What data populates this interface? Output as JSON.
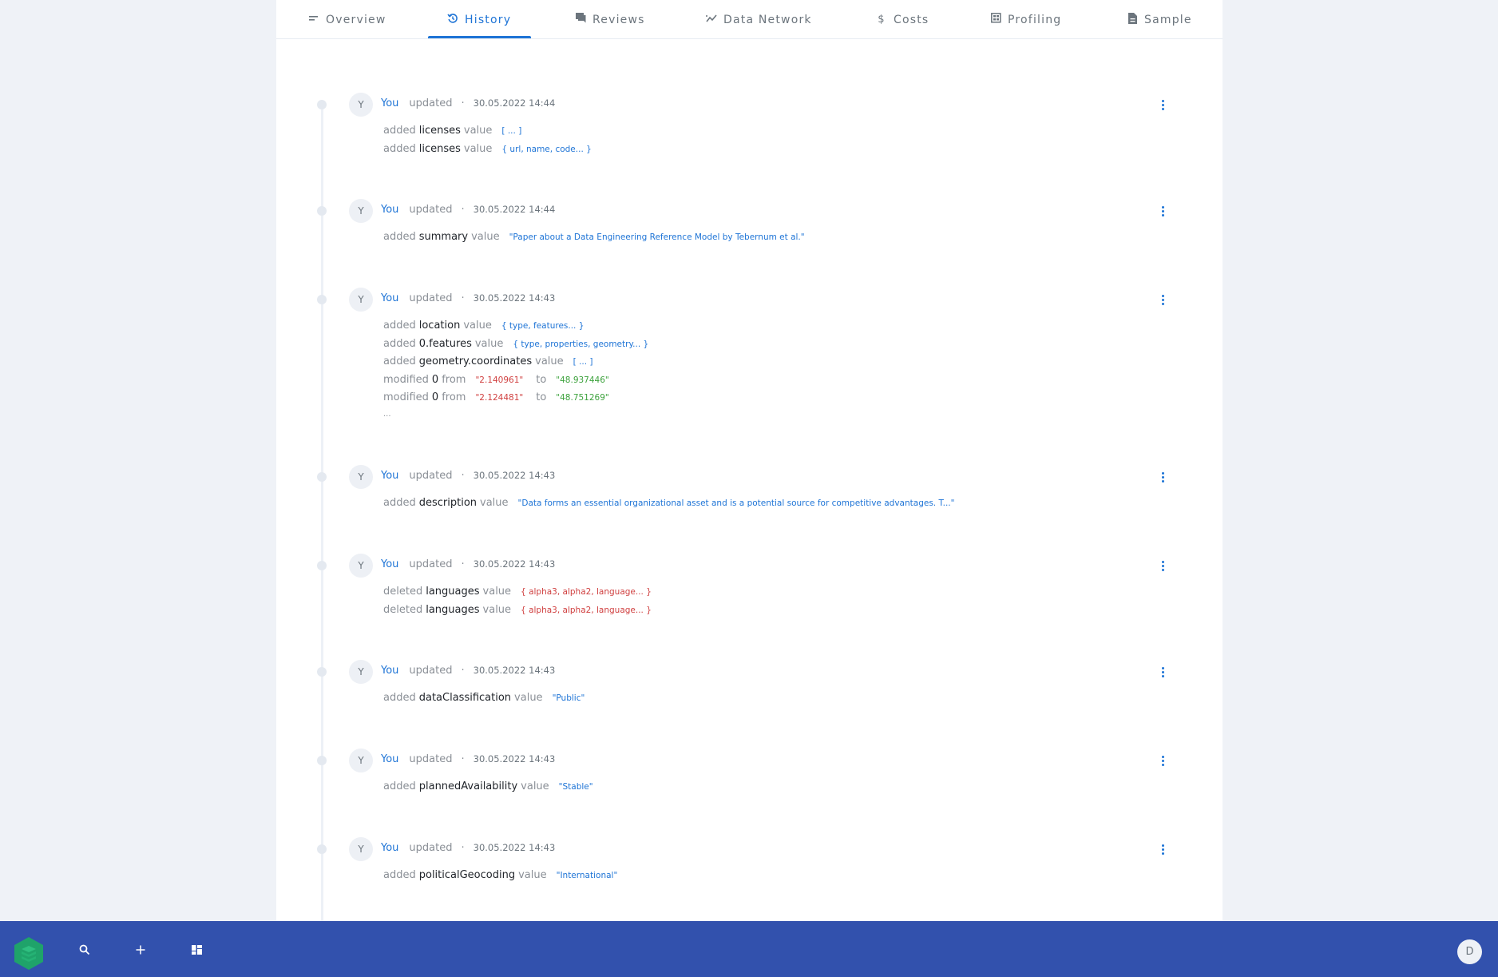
{
  "tabs": [
    {
      "id": "overview",
      "label": "Overview",
      "icon": "short-text-icon",
      "glyph": "≡",
      "active": false
    },
    {
      "id": "history",
      "label": "History",
      "icon": "history-icon",
      "glyph": "⟲",
      "active": true
    },
    {
      "id": "reviews",
      "label": "Reviews",
      "icon": "chat-icon",
      "glyph": "■",
      "active": false
    },
    {
      "id": "data-network",
      "label": "Data Network",
      "icon": "network-icon",
      "glyph": "≈",
      "active": false
    },
    {
      "id": "costs",
      "label": "Costs",
      "icon": "dollar-icon",
      "glyph": "$",
      "active": false
    },
    {
      "id": "profiling",
      "label": "Profiling",
      "icon": "profiling-icon",
      "glyph": "▦",
      "active": false
    },
    {
      "id": "sample",
      "label": "Sample",
      "icon": "document-icon",
      "glyph": "▤",
      "active": false
    }
  ],
  "history": [
    {
      "avatar": "Y",
      "user": "You",
      "action": "updated",
      "separator": "·",
      "timestamp": "30.05.2022 14:44",
      "changes": [
        {
          "kind": "added",
          "field": "licenses",
          "word": "value",
          "value": "[ ... ]",
          "color": "blue"
        },
        {
          "kind": "added",
          "field": "licenses",
          "word": "value",
          "value": "{ url, name, code... }",
          "color": "blue"
        }
      ]
    },
    {
      "avatar": "Y",
      "user": "You",
      "action": "updated",
      "separator": "·",
      "timestamp": "30.05.2022 14:44",
      "changes": [
        {
          "kind": "added",
          "field": "summary",
          "word": "value",
          "value": "\"Paper about a Data Engineering Reference Model by Tebernum et al.\"",
          "color": "blue"
        }
      ]
    },
    {
      "avatar": "Y",
      "user": "You",
      "action": "updated",
      "separator": "·",
      "timestamp": "30.05.2022 14:43",
      "changes": [
        {
          "kind": "added",
          "field": "location",
          "word": "value",
          "value": "{ type, features... }",
          "color": "blue"
        },
        {
          "kind": "added",
          "field": "0.features",
          "word": "value",
          "value": "{ type, properties, geometry... }",
          "color": "blue"
        },
        {
          "kind": "added",
          "field": "geometry.coordinates",
          "word": "value",
          "value": "[ ... ]",
          "color": "blue"
        },
        {
          "kind": "modified",
          "field": "0",
          "word": "from",
          "value": "\"2.140961\"",
          "color": "red",
          "to_word": "to",
          "to_value": "\"48.937446\""
        },
        {
          "kind": "modified",
          "field": "0",
          "word": "from",
          "value": "\"2.124481\"",
          "color": "red",
          "to_word": "to",
          "to_value": "\"48.751269\""
        }
      ],
      "more": "..."
    },
    {
      "avatar": "Y",
      "user": "You",
      "action": "updated",
      "separator": "·",
      "timestamp": "30.05.2022 14:43",
      "changes": [
        {
          "kind": "added",
          "field": "description",
          "word": "value",
          "value": "\"Data forms an essential organizational asset and is a potential source for competitive advantages. T...\"",
          "color": "blue"
        }
      ]
    },
    {
      "avatar": "Y",
      "user": "You",
      "action": "updated",
      "separator": "·",
      "timestamp": "30.05.2022 14:43",
      "changes": [
        {
          "kind": "deleted",
          "field": "languages",
          "word": "value",
          "value": "{ alpha3, alpha2, language... }",
          "color": "red"
        },
        {
          "kind": "deleted",
          "field": "languages",
          "word": "value",
          "value": "{ alpha3, alpha2, language... }",
          "color": "red"
        }
      ]
    },
    {
      "avatar": "Y",
      "user": "You",
      "action": "updated",
      "separator": "·",
      "timestamp": "30.05.2022 14:43",
      "changes": [
        {
          "kind": "added",
          "field": "dataClassification",
          "word": "value",
          "value": "\"Public\"",
          "color": "blue"
        }
      ]
    },
    {
      "avatar": "Y",
      "user": "You",
      "action": "updated",
      "separator": "·",
      "timestamp": "30.05.2022 14:43",
      "changes": [
        {
          "kind": "added",
          "field": "plannedAvailability",
          "word": "value",
          "value": "\"Stable\"",
          "color": "blue"
        }
      ]
    },
    {
      "avatar": "Y",
      "user": "You",
      "action": "updated",
      "separator": "·",
      "timestamp": "30.05.2022 14:43",
      "changes": [
        {
          "kind": "added",
          "field": "politicalGeocoding",
          "word": "value",
          "value": "\"International\"",
          "color": "blue"
        }
      ]
    }
  ],
  "bottombar": {
    "logo": "app-logo",
    "search_icon": "search-icon",
    "add_icon": "add-icon",
    "dashboard_icon": "dashboard-icon",
    "user_initial": "D"
  },
  "colors": {
    "accent": "#1e74d6",
    "bottombar": "#3251ad",
    "added_value": "#1e74d6",
    "deleted_value": "#d04040",
    "new_value": "#3ca23c",
    "logo": "#1fa36a"
  }
}
